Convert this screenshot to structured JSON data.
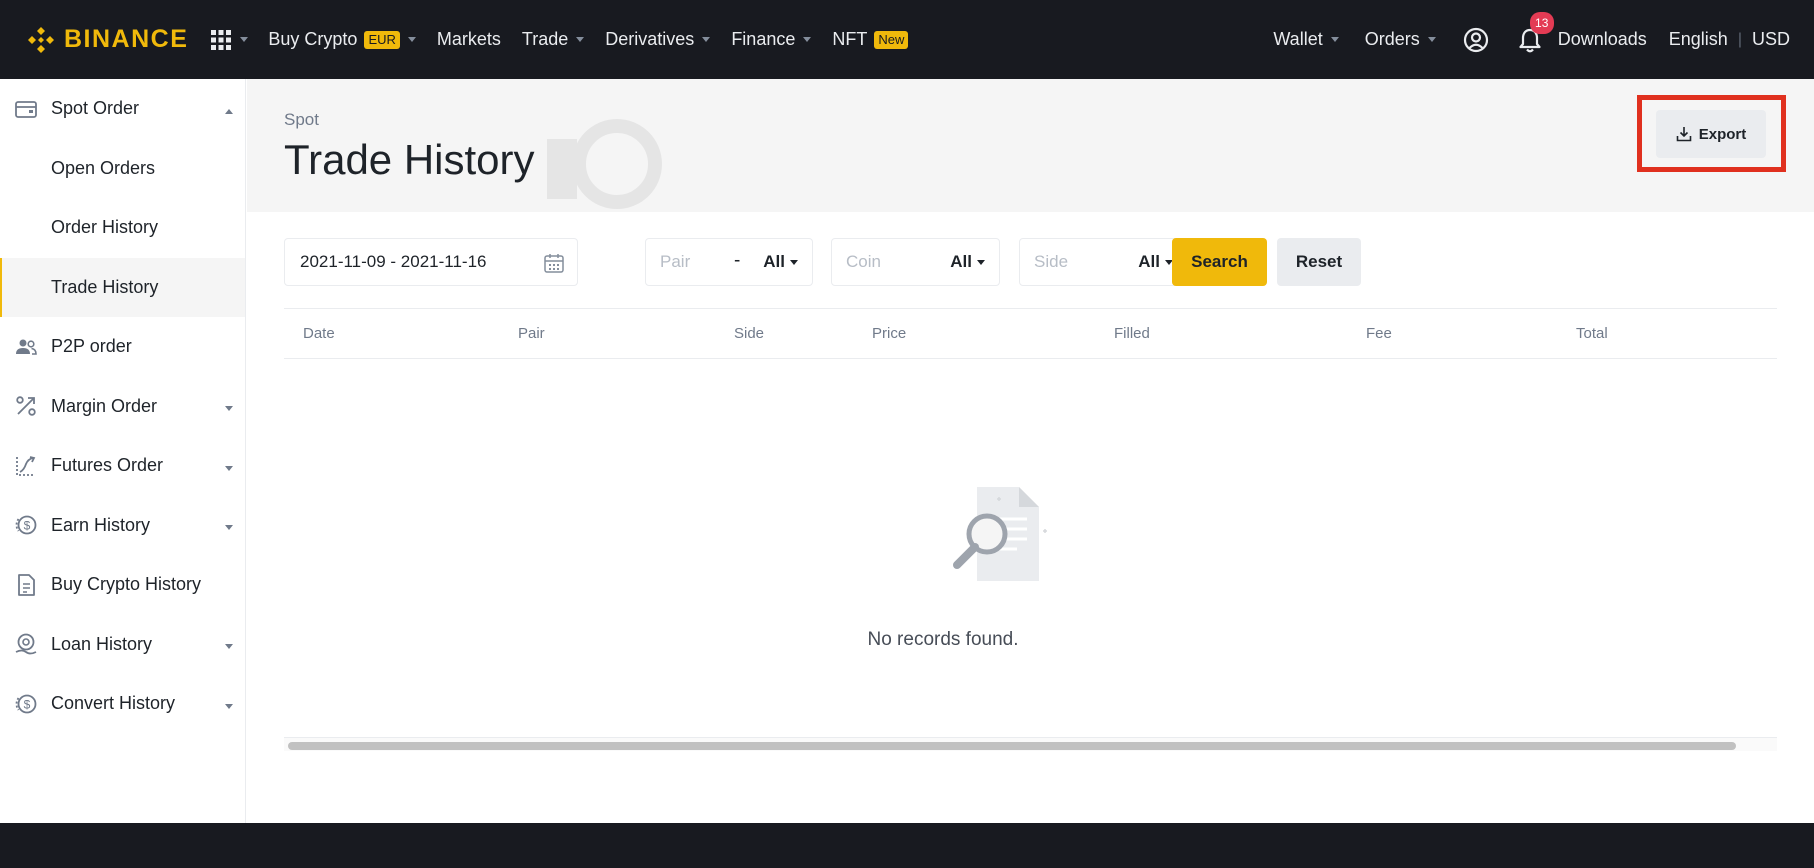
{
  "topbar": {
    "logo_text": "BINANCE",
    "nav": [
      {
        "label": "Buy Crypto",
        "badge": "EUR",
        "dropdown": true
      },
      {
        "label": "Markets",
        "dropdown": false
      },
      {
        "label": "Trade",
        "dropdown": true
      },
      {
        "label": "Derivatives",
        "dropdown": true
      },
      {
        "label": "Finance",
        "dropdown": true
      },
      {
        "label": "NFT",
        "badge": "New",
        "dropdown": false
      }
    ],
    "right": {
      "wallet": "Wallet",
      "orders": "Orders",
      "notification_count": "13",
      "downloads": "Downloads",
      "language": "English",
      "separator": "|",
      "currency": "USD"
    }
  },
  "sidebar": {
    "items": [
      {
        "label": "Spot Order",
        "icon": "wallet-icon",
        "arrow": "up"
      },
      {
        "label": "Open Orders",
        "sub": true
      },
      {
        "label": "Order History",
        "sub": true
      },
      {
        "label": "Trade History",
        "sub": true,
        "active": true
      },
      {
        "label": "P2P order",
        "icon": "people-icon"
      },
      {
        "label": "Margin Order",
        "icon": "percent-icon",
        "arrow": "down"
      },
      {
        "label": "Futures Order",
        "icon": "futures-icon",
        "arrow": "down"
      },
      {
        "label": "Earn History",
        "icon": "dollar-circle-icon",
        "arrow": "down"
      },
      {
        "label": "Buy Crypto History",
        "icon": "document-icon"
      },
      {
        "label": "Loan History",
        "icon": "loan-icon",
        "arrow": "down"
      },
      {
        "label": "Convert History",
        "icon": "convert-icon",
        "arrow": "down"
      }
    ]
  },
  "main": {
    "breadcrumb": "Spot",
    "title": "Trade History",
    "export_label": "Export",
    "filters": {
      "date_range": "2021-11-09 - 2021-11-16",
      "pair_placeholder": "Pair",
      "pair_value": "All",
      "dash": "-",
      "coin_placeholder": "Coin",
      "coin_value": "All",
      "side_placeholder": "Side",
      "side_value": "All",
      "search_label": "Search",
      "reset_label": "Reset"
    },
    "table": {
      "columns": [
        "Date",
        "Pair",
        "Side",
        "Price",
        "Filled",
        "Fee",
        "Total"
      ],
      "empty_text": "No records found."
    }
  },
  "colors": {
    "brand": "#f0b90b",
    "topbar_bg": "#181a20",
    "highlight_frame": "#e0301e",
    "notification": "#e33b54"
  }
}
